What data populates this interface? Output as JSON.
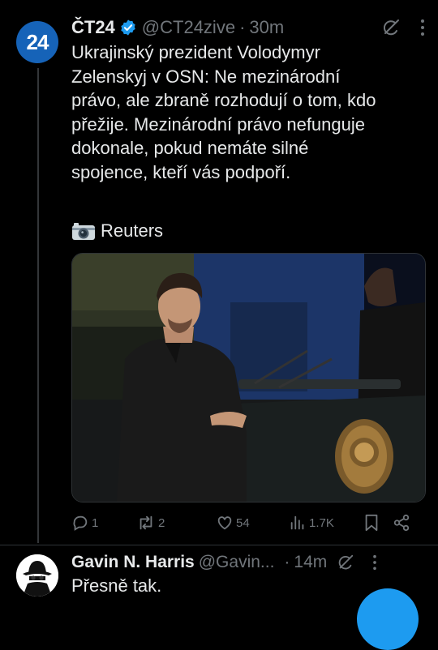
{
  "tweet": {
    "avatar_text": "24",
    "author_name": "ČT24",
    "handle": "@CT24zive",
    "separator": "·",
    "time": "30m",
    "text": "Ukrajinský prezident Volodymyr\nZelenskyj v OSN: Ne mezinárodní\nprávo, ale zbraně rozhodují o tom, kdo\npřežije. Mezinárodní právo nefunguje\ndokonale, pokud nemáte silné\nspojence, kteří vás podpoří.",
    "photo_credit": "Reuters",
    "stats": {
      "replies": "1",
      "retweets": "2",
      "likes": "54",
      "views": "1.7K"
    }
  },
  "reply": {
    "author_name": "Gavin N. Harris",
    "handle": "@Gavin...",
    "separator": "·",
    "time": "14m",
    "text": "Přesně tak."
  },
  "colors": {
    "background": "#000000",
    "text": "#e7e9ea",
    "muted": "#71767b",
    "accent": "#1d9bf0",
    "ct24_blue": "#1663b8"
  }
}
